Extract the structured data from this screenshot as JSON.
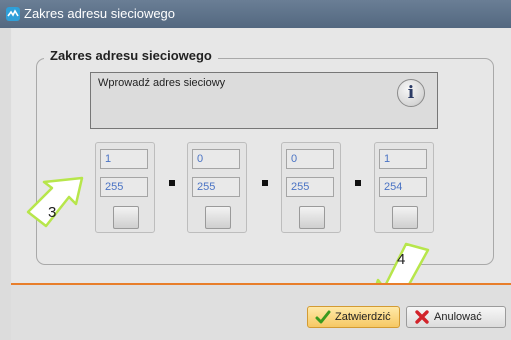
{
  "window": {
    "title": "Zakres adresu sieciowego"
  },
  "group": {
    "legend": "Zakres adresu sieciowego"
  },
  "info": {
    "text": "Wprowadź adres sieciowy",
    "icon": "info-icon",
    "icon_glyph": "i"
  },
  "octets": [
    {
      "start": "1",
      "end": "255"
    },
    {
      "start": "0",
      "end": "255"
    },
    {
      "start": "0",
      "end": "255"
    },
    {
      "start": "1",
      "end": "254"
    }
  ],
  "separator": ".",
  "callouts": [
    {
      "number": "3"
    },
    {
      "number": "4"
    }
  ],
  "buttons": {
    "ok_label": "Zatwierdzić",
    "ok_icon": "checkmark-icon",
    "cancel_label": "Anulować",
    "cancel_icon": "x-icon"
  },
  "colors": {
    "accent": "#e87e2b",
    "titlebar": "#5c7189",
    "value_text": "#4a73c4",
    "callout": "#b7e64b"
  }
}
